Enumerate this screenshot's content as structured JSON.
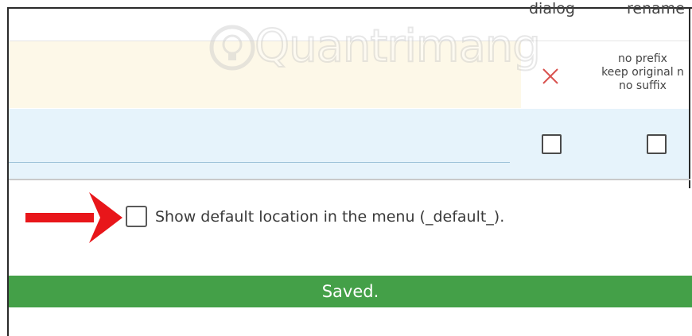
{
  "table": {
    "headers": {
      "dialog": "dialog",
      "rename": "rename"
    },
    "rename_row": {
      "lines": [
        "no prefix",
        "keep original n",
        "no suffix"
      ],
      "dialog_icon": "x-icon"
    },
    "checkbox_row": {
      "dialog_checked": false,
      "rename_checked": false
    }
  },
  "option": {
    "label": "Show default location in the menu (_default_).",
    "checked": false
  },
  "status": {
    "saved_text": "Saved.",
    "color": "#44a048"
  },
  "watermark": {
    "text": "Quantrimang"
  },
  "colors": {
    "arrow": "#e8161a",
    "x_icon": "#d9534f"
  }
}
